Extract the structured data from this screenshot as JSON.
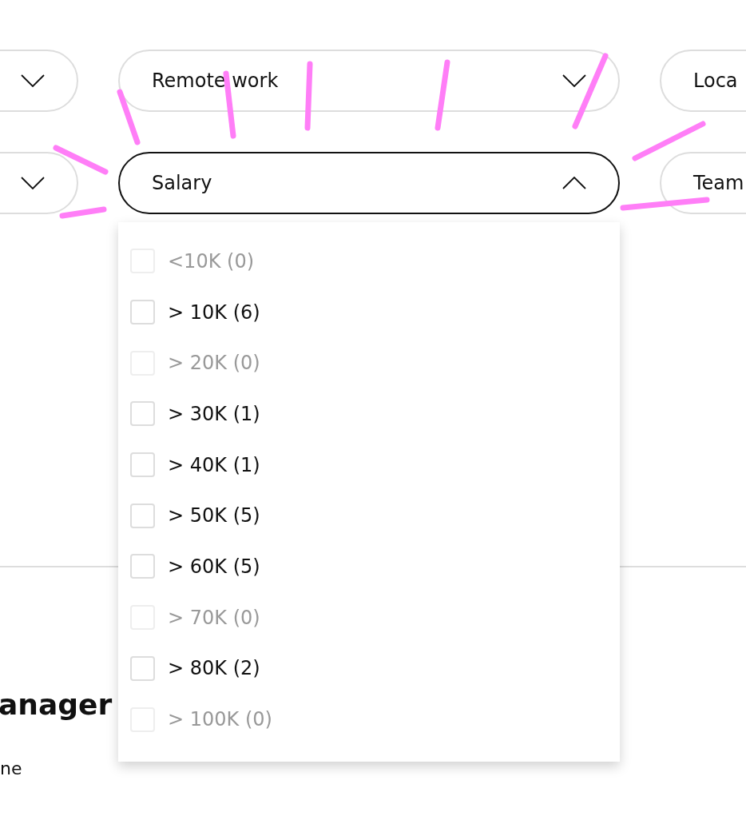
{
  "filters": [
    {
      "expanded": false
    },
    {
      "label": "Remote work",
      "expanded": false
    },
    {
      "label": "Loca"
    },
    {
      "expanded": false
    },
    {
      "label": "Salary",
      "expanded": true
    },
    {
      "label": "Team"
    }
  ],
  "dropdown": {
    "options": [
      {
        "label": "<10K (0)",
        "checked": false,
        "disabled": true
      },
      {
        "label": "> 10K (6)",
        "checked": false,
        "disabled": false
      },
      {
        "label": "> 20K (0)",
        "checked": false,
        "disabled": true
      },
      {
        "label": "> 30K (1)",
        "checked": false,
        "disabled": false
      },
      {
        "label": "> 40K (1)",
        "checked": false,
        "disabled": false
      },
      {
        "label": "> 50K (5)",
        "checked": false,
        "disabled": false
      },
      {
        "label": "> 60K (5)",
        "checked": false,
        "disabled": false
      },
      {
        "label": "> 70K (0)",
        "checked": false,
        "disabled": true
      },
      {
        "label": "> 80K (2)",
        "checked": false,
        "disabled": false
      },
      {
        "label": "> 100K (0)",
        "checked": false,
        "disabled": true
      }
    ]
  },
  "job": {
    "title": "anager",
    "subtitle": "ne"
  }
}
